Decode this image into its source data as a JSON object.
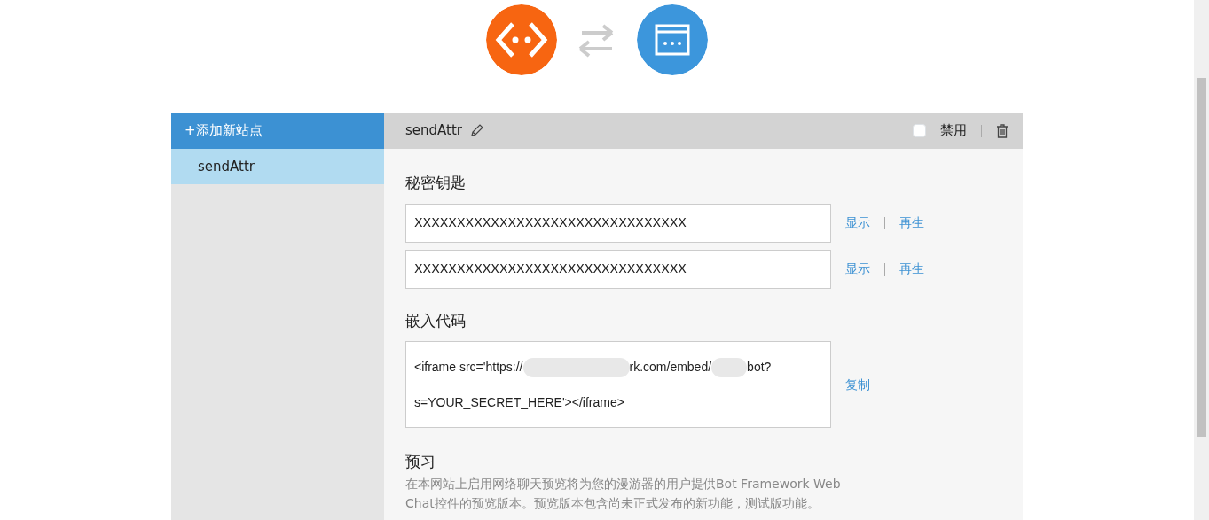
{
  "sidebar": {
    "add_button": "+添加新站点",
    "items": [
      {
        "label": "sendAttr",
        "selected": true
      }
    ]
  },
  "site": {
    "name": "sendAttr",
    "disable_label": "禁用",
    "disabled": false
  },
  "secret_keys": {
    "heading": "秘密钥匙",
    "keys": [
      {
        "value": "XXXXXXXXXXXXXXXXXXXXXXXXXXXXXXXX",
        "show": "显示",
        "regenerate": "再生"
      },
      {
        "value": "XXXXXXXXXXXXXXXXXXXXXXXXXXXXXXXX",
        "show": "显示",
        "regenerate": "再生"
      }
    ]
  },
  "embed": {
    "heading": "嵌入代码",
    "code_segments": [
      "<iframe src='https://",
      "rk.com/embed/",
      "bot?"
    ],
    "code_line_2": "s=YOUR_SECRET_HERE'></iframe>",
    "copy": "复制"
  },
  "preview": {
    "heading": "预习",
    "description": "在本网站上启用网络聊天预览将为您的漫游器的用户提供Bot Framework Web Chat控件的预览版本。预览版本包含尚未正式发布的新功能，测试版功能。"
  }
}
